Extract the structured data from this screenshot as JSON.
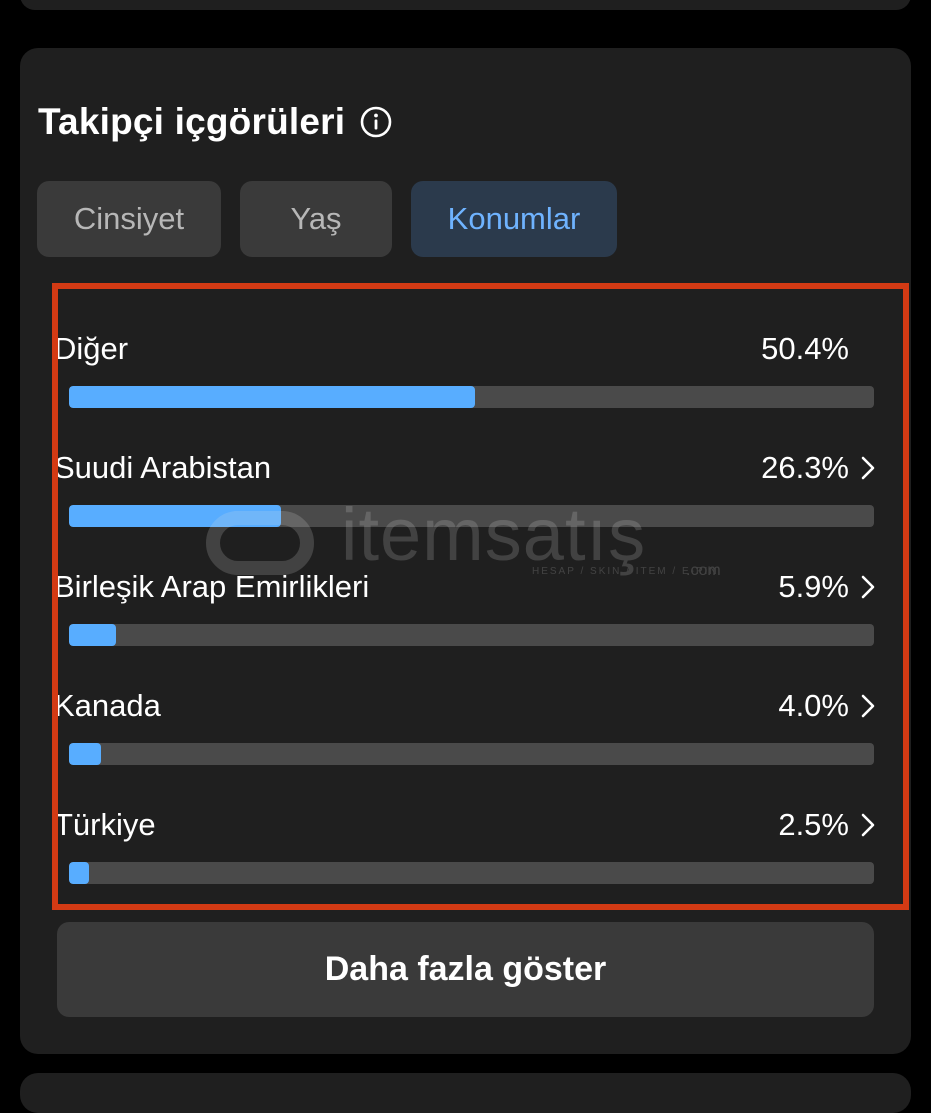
{
  "header": {
    "title": "Takipçi içgörüleri",
    "info_icon": "info-icon"
  },
  "tabs": [
    {
      "label": "Cinsiyet",
      "selected": false
    },
    {
      "label": "Yaş",
      "selected": false
    },
    {
      "label": "Konumlar",
      "selected": true
    }
  ],
  "locations": [
    {
      "name": "Diğer",
      "percent_label": "50.4%",
      "percent": 50.4,
      "has_chevron": false
    },
    {
      "name": "Suudi Arabistan",
      "percent_label": "26.3%",
      "percent": 26.3,
      "has_chevron": true
    },
    {
      "name": "Birleşik Arap Emirlikleri",
      "percent_label": "5.9%",
      "percent": 5.9,
      "has_chevron": true
    },
    {
      "name": "Kanada",
      "percent_label": "4.0%",
      "percent": 4.0,
      "has_chevron": true
    },
    {
      "name": "Türkiye",
      "percent_label": "2.5%",
      "percent": 2.5,
      "has_chevron": true
    }
  ],
  "more_button": {
    "label": "Daha fazla göster"
  },
  "watermark": {
    "text": "itemsatış",
    "subtext": "HESAP / SKIN / ITEM / E-PIN",
    "suffix": ".com"
  },
  "colors": {
    "accent": "#58adff",
    "selected_tab_text": "#6fb3ff",
    "highlight_border": "#d33a14",
    "card_bg": "#1f1f1f"
  }
}
